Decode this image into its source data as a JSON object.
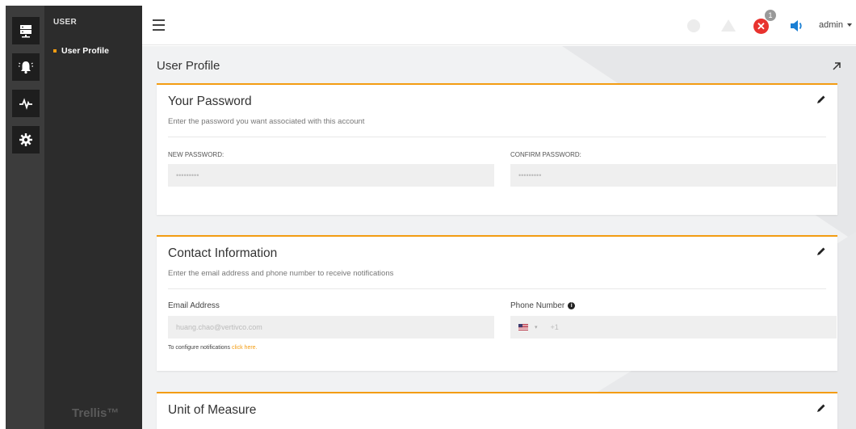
{
  "sidebar": {
    "rail_items": [
      {
        "icon": "server-icon"
      },
      {
        "icon": "alarm-bell-icon"
      },
      {
        "icon": "pulse-icon"
      },
      {
        "icon": "gear-icon"
      }
    ],
    "section": "USER",
    "items": [
      {
        "label": "User Profile"
      }
    ],
    "brand": "Trellis™"
  },
  "header": {
    "menu_icon": "hamburger-icon",
    "alarm_count": "1",
    "user": "admin"
  },
  "main": {
    "title": "User Profile",
    "password": {
      "title": "Your Password",
      "subtitle": "Enter the password you want associated with this account",
      "new_label": "NEW PASSWORD:",
      "new_value": "•••••••••",
      "confirm_label": "CONFIRM PASSWORD:",
      "confirm_value": "•••••••••"
    },
    "contact": {
      "title": "Contact Information",
      "subtitle": "Enter the email address and phone number to receive notifications",
      "email_label": "Email Address",
      "email_value": "huang.chao@vertivco.com",
      "phone_label": "Phone Number",
      "phone_code": "+1",
      "note_text": "To configure notifications ",
      "note_link": "click here."
    },
    "units": {
      "title": "Unit of Measure"
    }
  },
  "colors": {
    "accent": "#f39c12",
    "critical": "#e8322e",
    "sound": "#1a7fd4"
  }
}
